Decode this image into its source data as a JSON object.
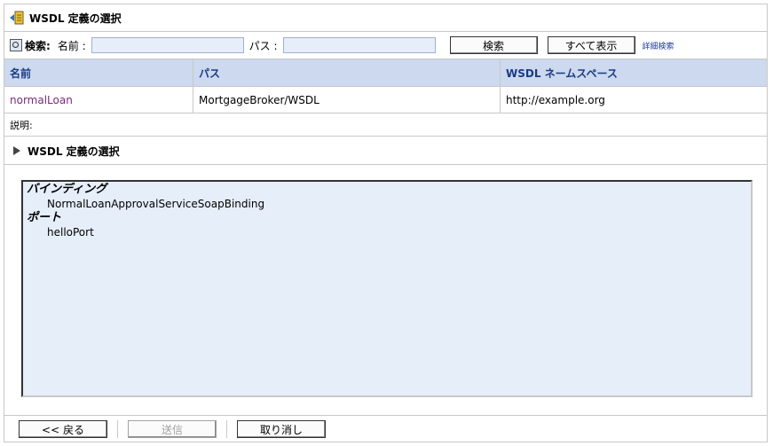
{
  "title": "WSDL 定義の選択",
  "search": {
    "label": "検索:",
    "name_label": "名前 :",
    "name_value": "",
    "path_label": "パス :",
    "path_value": "",
    "search_button": "検索",
    "show_all_button": "すべて表示",
    "advanced_link": "詳細検索"
  },
  "table": {
    "headers": [
      "名前",
      "パス",
      "WSDL ネームスペース"
    ],
    "rows": [
      [
        "normalLoan",
        "MortgageBroker/WSDL",
        "http://example.org"
      ]
    ]
  },
  "description_label": "説明:",
  "section": {
    "title": "WSDL 定義の選択"
  },
  "details": {
    "binding_label": "バインディング",
    "binding_value": "NormalLoanApprovalServiceSoapBinding",
    "port_label": "ポート",
    "port_value": "helloPort"
  },
  "footer": {
    "back_button": "<< 戻る",
    "submit_button": "送信",
    "cancel_button": "取り消し"
  }
}
